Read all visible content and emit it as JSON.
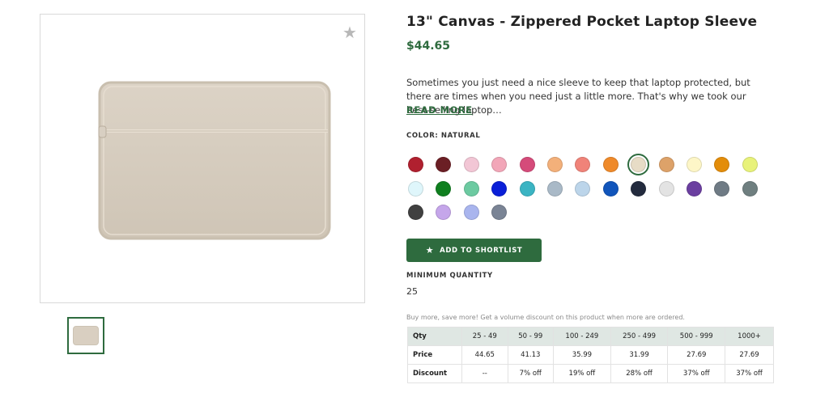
{
  "product": {
    "title": "13\" Canvas - Zippered Pocket Laptop Sleeve",
    "price": "$44.65",
    "description": "Sometimes you just need a nice sleeve to keep that laptop protected, but there are times when you need just a little more. That's why we took our best-selling laptop…",
    "read_more": "READ MORE"
  },
  "icons": {
    "favorite": "star-icon",
    "add": "star-icon"
  },
  "color": {
    "label": "COLOR: NATURAL",
    "selected_index": 8,
    "swatches": [
      "#b0202f",
      "#6b1f25",
      "#f2c6d5",
      "#f2a6b8",
      "#d54b7a",
      "#f3b07a",
      "#f08379",
      "#ef8a2a",
      "#e7dcc6",
      "#dda269",
      "#fdf6c7",
      "#e38d0a",
      "#e8f27a",
      "#dff6fb",
      "#0f7f1f",
      "#6ccaa1",
      "#0a1fd8",
      "#3bb4c3",
      "#a9b9c7",
      "#bcd5ea",
      "#1155bb",
      "#232b3e",
      "#e3e3e3",
      "#6b3fa0",
      "#6f7b85",
      "#6f7f80",
      "#404040",
      "#c5a6ea",
      "#a9b5ee",
      "#7a8495"
    ]
  },
  "actions": {
    "add_to_shortlist": "ADD TO SHORTLIST"
  },
  "minimum": {
    "label": "MINIMUM QUANTITY",
    "value": "25"
  },
  "pricing": {
    "note": "Buy more, save more! Get a volume discount on this product when more are ordered.",
    "headers": [
      "Qty",
      "25 - 49",
      "50 - 99",
      "100 - 249",
      "250 - 499",
      "500 - 999",
      "1000+"
    ],
    "price_row": [
      "Price",
      "44.65",
      "41.13",
      "35.99",
      "31.99",
      "27.69",
      "27.69"
    ],
    "discount_row": [
      "Discount",
      "--",
      "7% off",
      "19% off",
      "28% off",
      "37% off",
      "37% off"
    ]
  },
  "colors": {
    "brand": "#2e6b3e",
    "product_canvas": "#d9cfc1"
  }
}
